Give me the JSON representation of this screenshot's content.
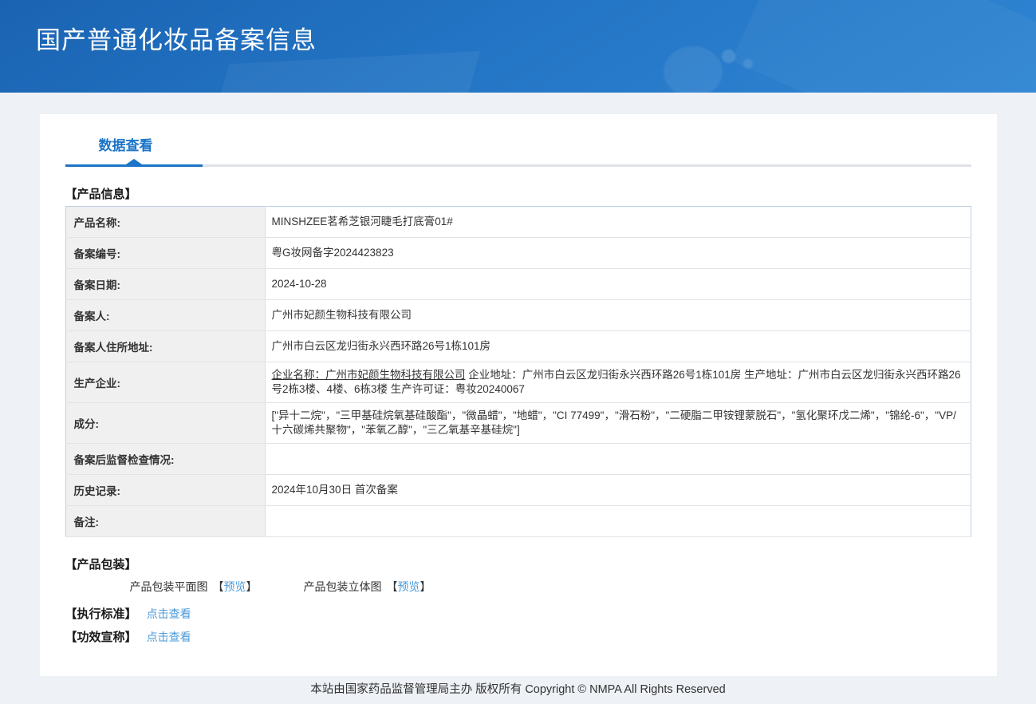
{
  "theme": {
    "accent_blue": "#1b74c8",
    "link_blue": "#4a9ada",
    "banner_gradient_top": "#1a63b2",
    "banner_gradient_bottom": "#2f86d3",
    "label_cell_bg": "#f0f0f0",
    "table_border": "#b9cfe6",
    "page_bg": "#eef1f5"
  },
  "header": {
    "title": "国产普通化妆品备案信息"
  },
  "tabs": {
    "data_view": "数据查看"
  },
  "brackets": {
    "open": "【",
    "close": "】"
  },
  "sections": {
    "product_info_title": "【产品信息】",
    "packaging_title": "【产品包装】",
    "standard_title": "【执行标准】",
    "claims_title": "【功效宣称】"
  },
  "product_info": {
    "rows": [
      {
        "label": "产品名称:",
        "value": "MINSHZEE茗希芝银河睫毛打底膏01#"
      },
      {
        "label": "备案编号:",
        "value": "粤G妆网备字2024423823"
      },
      {
        "label": "备案日期:",
        "value": "2024-10-28"
      },
      {
        "label": "备案人:",
        "value": "广州市妃颜生物科技有限公司"
      },
      {
        "label": "备案人住所地址:",
        "value": "广州市白云区龙归街永兴西环路26号1栋101房"
      },
      {
        "label": "生产企业:",
        "tall": true,
        "parts": [
          {
            "text": "企业名称：广州市妃颜生物科技有限公司",
            "underlined": true
          },
          {
            "text": " 企业地址：广州市白云区龙归街永兴西环路26号1栋101房 生产地址：广州市白云区龙归街永兴西环路26号2栋3楼、4楼、6栋3楼 生产许可证：粤妆20240067"
          }
        ]
      },
      {
        "label": "成分:",
        "tall": true,
        "value": "[\"异十二烷\"，\"三甲基硅烷氧基硅酸酯\"，\"微晶蜡\"，\"地蜡\"，\"CI 77499\"，\"滑石粉\"，\"二硬脂二甲铵锂蒙脱石\"，\"氢化聚环戊二烯\"，\"锦纶-6\"，\"VP/十六碳烯共聚物\"，\"苯氧乙醇\"，\"三乙氧基辛基硅烷\"]"
      },
      {
        "label": "备案后监督检查情况:",
        "value": ""
      },
      {
        "label": "历史记录:",
        "value": "2024年10月30日 首次备案"
      },
      {
        "label": "备注:",
        "value": ""
      }
    ]
  },
  "packaging": {
    "items": [
      {
        "label": "产品包装平面图",
        "link": "预览"
      },
      {
        "label": "产品包装立体图",
        "link": "预览"
      }
    ]
  },
  "standard": {
    "link": "点击查看"
  },
  "claims": {
    "link": "点击查看"
  },
  "footer": {
    "text": "本站由国家药品监督管理局主办 版权所有 Copyright © NMPA All Rights Reserved"
  }
}
